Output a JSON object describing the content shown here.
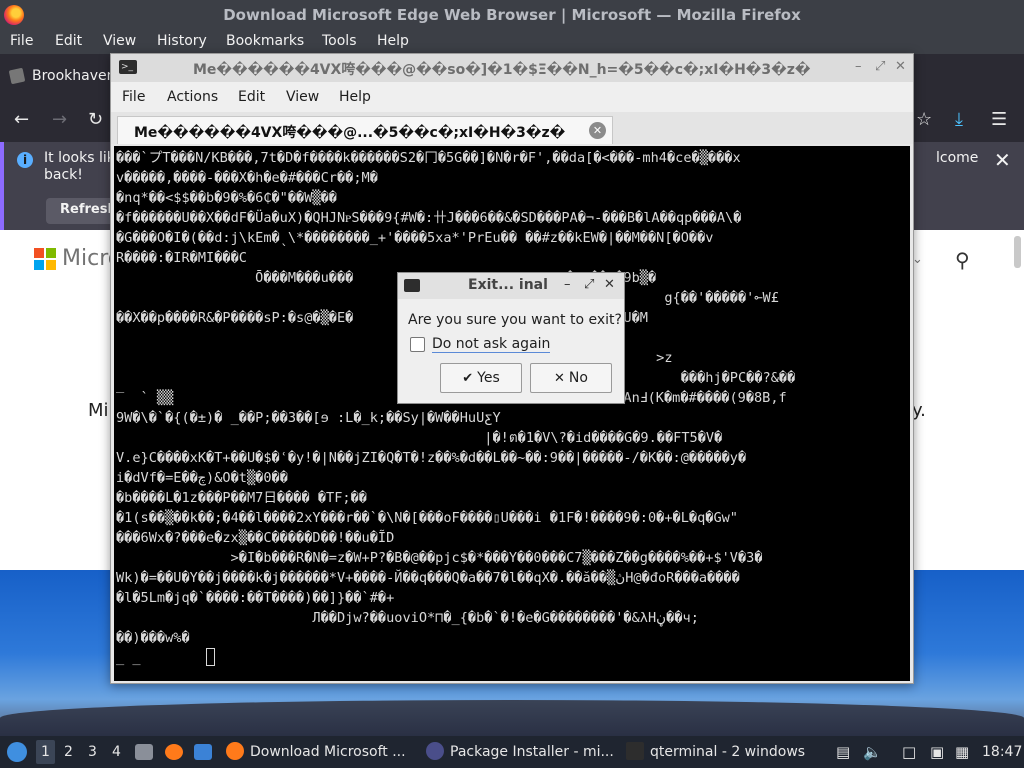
{
  "firefox": {
    "window_title": "Download Microsoft Edge Web Browser | Microsoft — Mozilla Firefox",
    "menu": [
      "File",
      "Edit",
      "View",
      "History",
      "Bookmarks",
      "Tools",
      "Help"
    ],
    "tab_label": "Brookhaven",
    "notification": {
      "text_left": "It looks like",
      "text_left2": "back!",
      "text_right": "lcome",
      "refresh_label": "Refresh"
    },
    "page": {
      "brand_text": "Micro",
      "text_left": "Mi",
      "text_right": "y."
    },
    "colors": {
      "download_icon": "#4cc2ff",
      "notification_accent": "#8d6bff"
    }
  },
  "terminal": {
    "title": "Me������4VX咵���@��so�]�1�$Ξ��N_h=�5��c�;xI�H�3�z�",
    "menu": [
      "File",
      "Actions",
      "Edit",
      "View",
      "Help"
    ],
    "tab_label": "Me������4VX咵���@...�5��c�;xI�H�3�z�",
    "screen_text": "���`プT���N/KB���,7t�D�f����k������S2�冂�5G��]�N�r�F',��da[�<���-mh4�ce�▒���x\nv�����,����-���X�h�e�#���Cr��;M�\n�nq*��<$$��b�9�%�6₵�\"��W▒��\n�f������U��X��dF�Üa�uX)�QHJNᴩS���9{#W�:卄J���6��&�SD���PA�¬-���B�lA��qp���A\\�\n�G���O�I�(��d:j\\kEm�ˎ\\*��������_+'����5xa*'PrEu�� ��#z��kEW�|��M��N[�O��v\nR����:�IR�MI���C\n                 Ō���M���u���                          �1.��~�9b▒�\n                                                                   g{��'�����'⟜W£\n��X��p����R&�P����sP:�s@�▒�E�                          �@��eH�U�M\n\n                                                                  >z\n                                                                     ���hj�PC��?&��\n‾  ` ▒▒                                                   ��,�AnℲ(K�m�#����(9�8B,f\n9W�\\�`�{(�±)� _��P;��3��[ɘ :L�_k;��Sy|�W��HuUƹY\n                                             |�!ต�1�V\\?�id����G�9.��FT5�V�\nV.e}C����xK�T+��U�$�ʿ�y!�|N��jZI�Q�T�!z��%�d��L��~��:9��|�����-/�K��:@�����y�\ni�dVf�=E��چ)&O�t▒�0��\n�b����L�1z���P��M7日���� �TF;��\n�1(s��▒��k��;�4��l����2xY���r��`�\\N�[���oF����▯U���i �1F�!����9�:0�+�L�q�Gw\"\n���6Wx�?���e�zx▒��C�����D��!��u�ĨD\n              >�I�b���R�N�=z�W+P?�B�@��pjc$�*���Y��0���C7▒���Z��g����%��+$'V�3�\nWk)�=��U�Y��j����k�j������*V+����-Й��q���Q�a��7�l��qX�.��ă��▒ڽH@�đoR���a����\n�l�5Lm�jq�`����:��T����)��]}��`#�+\n                        Л��Djw?��uoviO*⊓�_{�b�`�!�e�G��������'�&λHڼ��ч;\n��)���w%�\n_ _"
  },
  "dialog": {
    "title": "Exit... inal",
    "question": "Are you sure you want to exit?",
    "checkbox_label": "Do not ask again",
    "yes_label": "Yes",
    "no_label": "No",
    "yes_icon": "check-icon",
    "no_icon": "x-icon"
  },
  "taskbar": {
    "workspaces": [
      "1",
      "2",
      "3",
      "4"
    ],
    "tasks": [
      {
        "label": "Download Microsoft ...",
        "icon": "firefox-icon"
      },
      {
        "label": "Package Installer - mi...",
        "icon": "package-icon"
      },
      {
        "label": "qterminal - 2 windows",
        "icon": "terminal-icon"
      }
    ],
    "clock": "18:47"
  }
}
